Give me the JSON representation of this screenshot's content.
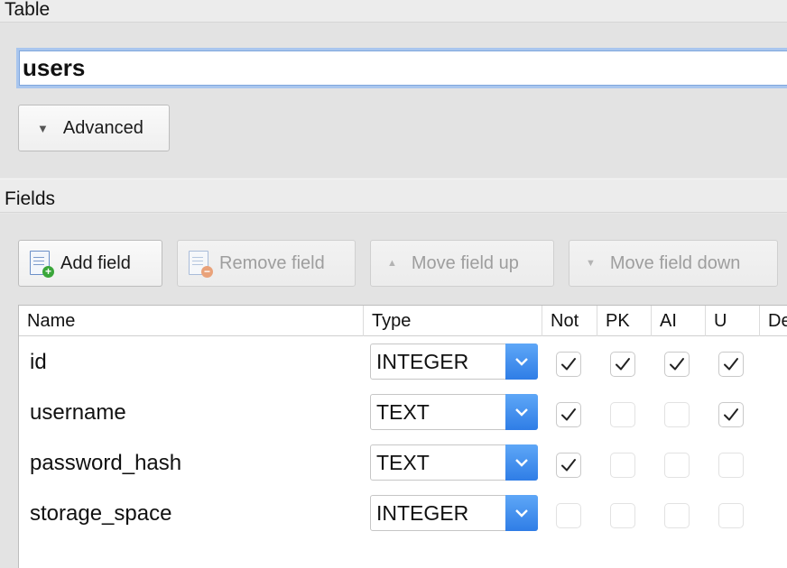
{
  "sections": {
    "table_label": "Table",
    "fields_label": "Fields"
  },
  "table": {
    "name_value": "users",
    "advanced_label": "Advanced"
  },
  "toolbar": {
    "add_field": "Add field",
    "remove_field": "Remove field",
    "move_up": "Move field up",
    "move_down": "Move field down"
  },
  "columns": {
    "name": "Name",
    "type": "Type",
    "not": "Not",
    "pk": "PK",
    "ai": "AI",
    "u": "U",
    "default": "De"
  },
  "rows": [
    {
      "name": "id",
      "type": "INTEGER",
      "not": true,
      "pk": true,
      "ai": true,
      "u": true
    },
    {
      "name": "username",
      "type": "TEXT",
      "not": true,
      "pk": false,
      "ai": false,
      "u": true
    },
    {
      "name": "password_hash",
      "type": "TEXT",
      "not": true,
      "pk": false,
      "ai": false,
      "u": false
    },
    {
      "name": "storage_space",
      "type": "INTEGER",
      "not": false,
      "pk": false,
      "ai": false,
      "u": false
    }
  ],
  "colors": {
    "accent_blue": "#2f7de6",
    "focus_ring": "#a9c6ee"
  },
  "icons": {
    "advanced": "triangle-down-icon",
    "add_field": "document-add-icon",
    "remove_field": "document-remove-icon",
    "move_up": "triangle-up-icon",
    "move_down": "triangle-down-icon",
    "select_arrow": "chevron-down-icon",
    "check": "checkmark-icon"
  }
}
